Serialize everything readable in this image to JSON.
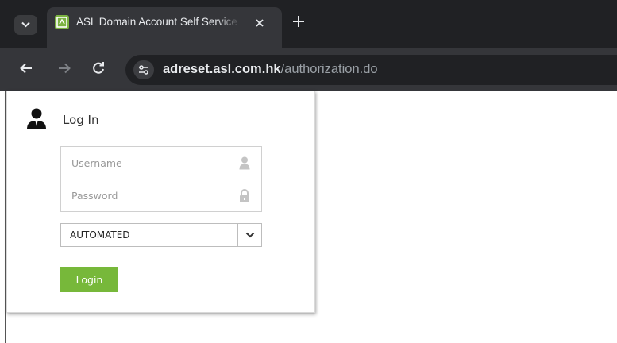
{
  "browser": {
    "tab": {
      "title": "ASL Domain Account Self Service"
    },
    "address_bar": {
      "host": "adreset.asl.com.hk",
      "path": "/authorization.do"
    }
  },
  "login": {
    "title": "Log In",
    "username_placeholder": "Username",
    "password_placeholder": "Password",
    "domain_selected": "AUTOMATED",
    "submit_label": "Login"
  },
  "colors": {
    "accent_green": "#77b83a",
    "chrome_dark": "#202124",
    "chrome_toolbar": "#35363a"
  }
}
